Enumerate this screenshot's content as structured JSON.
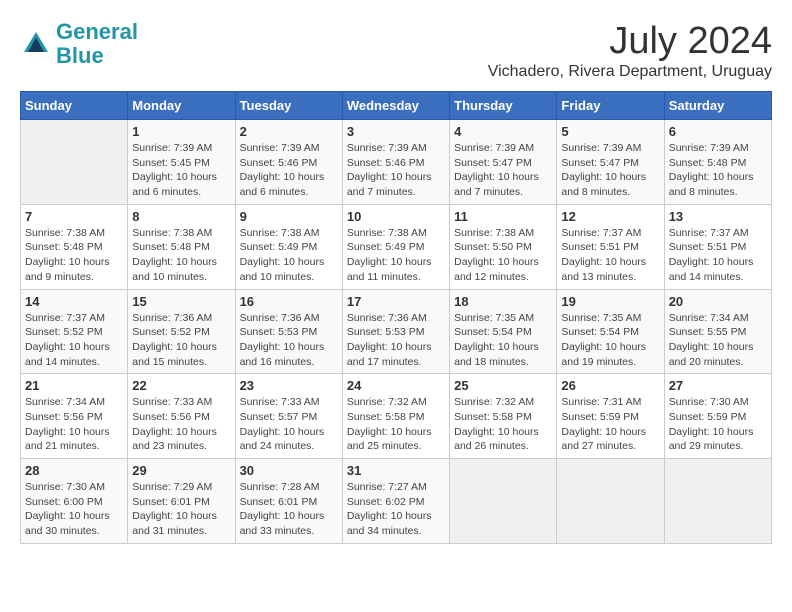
{
  "header": {
    "logo_line1": "General",
    "logo_line2": "Blue",
    "month_year": "July 2024",
    "location": "Vichadero, Rivera Department, Uruguay"
  },
  "days_of_week": [
    "Sunday",
    "Monday",
    "Tuesday",
    "Wednesday",
    "Thursday",
    "Friday",
    "Saturday"
  ],
  "weeks": [
    [
      {
        "day": "",
        "sunrise": "",
        "sunset": "",
        "daylight": ""
      },
      {
        "day": "1",
        "sunrise": "Sunrise: 7:39 AM",
        "sunset": "Sunset: 5:45 PM",
        "daylight": "Daylight: 10 hours and 6 minutes."
      },
      {
        "day": "2",
        "sunrise": "Sunrise: 7:39 AM",
        "sunset": "Sunset: 5:46 PM",
        "daylight": "Daylight: 10 hours and 6 minutes."
      },
      {
        "day": "3",
        "sunrise": "Sunrise: 7:39 AM",
        "sunset": "Sunset: 5:46 PM",
        "daylight": "Daylight: 10 hours and 7 minutes."
      },
      {
        "day": "4",
        "sunrise": "Sunrise: 7:39 AM",
        "sunset": "Sunset: 5:47 PM",
        "daylight": "Daylight: 10 hours and 7 minutes."
      },
      {
        "day": "5",
        "sunrise": "Sunrise: 7:39 AM",
        "sunset": "Sunset: 5:47 PM",
        "daylight": "Daylight: 10 hours and 8 minutes."
      },
      {
        "day": "6",
        "sunrise": "Sunrise: 7:39 AM",
        "sunset": "Sunset: 5:48 PM",
        "daylight": "Daylight: 10 hours and 8 minutes."
      }
    ],
    [
      {
        "day": "7",
        "sunrise": "Sunrise: 7:38 AM",
        "sunset": "Sunset: 5:48 PM",
        "daylight": "Daylight: 10 hours and 9 minutes."
      },
      {
        "day": "8",
        "sunrise": "Sunrise: 7:38 AM",
        "sunset": "Sunset: 5:48 PM",
        "daylight": "Daylight: 10 hours and 10 minutes."
      },
      {
        "day": "9",
        "sunrise": "Sunrise: 7:38 AM",
        "sunset": "Sunset: 5:49 PM",
        "daylight": "Daylight: 10 hours and 10 minutes."
      },
      {
        "day": "10",
        "sunrise": "Sunrise: 7:38 AM",
        "sunset": "Sunset: 5:49 PM",
        "daylight": "Daylight: 10 hours and 11 minutes."
      },
      {
        "day": "11",
        "sunrise": "Sunrise: 7:38 AM",
        "sunset": "Sunset: 5:50 PM",
        "daylight": "Daylight: 10 hours and 12 minutes."
      },
      {
        "day": "12",
        "sunrise": "Sunrise: 7:37 AM",
        "sunset": "Sunset: 5:51 PM",
        "daylight": "Daylight: 10 hours and 13 minutes."
      },
      {
        "day": "13",
        "sunrise": "Sunrise: 7:37 AM",
        "sunset": "Sunset: 5:51 PM",
        "daylight": "Daylight: 10 hours and 14 minutes."
      }
    ],
    [
      {
        "day": "14",
        "sunrise": "Sunrise: 7:37 AM",
        "sunset": "Sunset: 5:52 PM",
        "daylight": "Daylight: 10 hours and 14 minutes."
      },
      {
        "day": "15",
        "sunrise": "Sunrise: 7:36 AM",
        "sunset": "Sunset: 5:52 PM",
        "daylight": "Daylight: 10 hours and 15 minutes."
      },
      {
        "day": "16",
        "sunrise": "Sunrise: 7:36 AM",
        "sunset": "Sunset: 5:53 PM",
        "daylight": "Daylight: 10 hours and 16 minutes."
      },
      {
        "day": "17",
        "sunrise": "Sunrise: 7:36 AM",
        "sunset": "Sunset: 5:53 PM",
        "daylight": "Daylight: 10 hours and 17 minutes."
      },
      {
        "day": "18",
        "sunrise": "Sunrise: 7:35 AM",
        "sunset": "Sunset: 5:54 PM",
        "daylight": "Daylight: 10 hours and 18 minutes."
      },
      {
        "day": "19",
        "sunrise": "Sunrise: 7:35 AM",
        "sunset": "Sunset: 5:54 PM",
        "daylight": "Daylight: 10 hours and 19 minutes."
      },
      {
        "day": "20",
        "sunrise": "Sunrise: 7:34 AM",
        "sunset": "Sunset: 5:55 PM",
        "daylight": "Daylight: 10 hours and 20 minutes."
      }
    ],
    [
      {
        "day": "21",
        "sunrise": "Sunrise: 7:34 AM",
        "sunset": "Sunset: 5:56 PM",
        "daylight": "Daylight: 10 hours and 21 minutes."
      },
      {
        "day": "22",
        "sunrise": "Sunrise: 7:33 AM",
        "sunset": "Sunset: 5:56 PM",
        "daylight": "Daylight: 10 hours and 23 minutes."
      },
      {
        "day": "23",
        "sunrise": "Sunrise: 7:33 AM",
        "sunset": "Sunset: 5:57 PM",
        "daylight": "Daylight: 10 hours and 24 minutes."
      },
      {
        "day": "24",
        "sunrise": "Sunrise: 7:32 AM",
        "sunset": "Sunset: 5:58 PM",
        "daylight": "Daylight: 10 hours and 25 minutes."
      },
      {
        "day": "25",
        "sunrise": "Sunrise: 7:32 AM",
        "sunset": "Sunset: 5:58 PM",
        "daylight": "Daylight: 10 hours and 26 minutes."
      },
      {
        "day": "26",
        "sunrise": "Sunrise: 7:31 AM",
        "sunset": "Sunset: 5:59 PM",
        "daylight": "Daylight: 10 hours and 27 minutes."
      },
      {
        "day": "27",
        "sunrise": "Sunrise: 7:30 AM",
        "sunset": "Sunset: 5:59 PM",
        "daylight": "Daylight: 10 hours and 29 minutes."
      }
    ],
    [
      {
        "day": "28",
        "sunrise": "Sunrise: 7:30 AM",
        "sunset": "Sunset: 6:00 PM",
        "daylight": "Daylight: 10 hours and 30 minutes."
      },
      {
        "day": "29",
        "sunrise": "Sunrise: 7:29 AM",
        "sunset": "Sunset: 6:01 PM",
        "daylight": "Daylight: 10 hours and 31 minutes."
      },
      {
        "day": "30",
        "sunrise": "Sunrise: 7:28 AM",
        "sunset": "Sunset: 6:01 PM",
        "daylight": "Daylight: 10 hours and 33 minutes."
      },
      {
        "day": "31",
        "sunrise": "Sunrise: 7:27 AM",
        "sunset": "Sunset: 6:02 PM",
        "daylight": "Daylight: 10 hours and 34 minutes."
      },
      {
        "day": "",
        "sunrise": "",
        "sunset": "",
        "daylight": ""
      },
      {
        "day": "",
        "sunrise": "",
        "sunset": "",
        "daylight": ""
      },
      {
        "day": "",
        "sunrise": "",
        "sunset": "",
        "daylight": ""
      }
    ]
  ]
}
